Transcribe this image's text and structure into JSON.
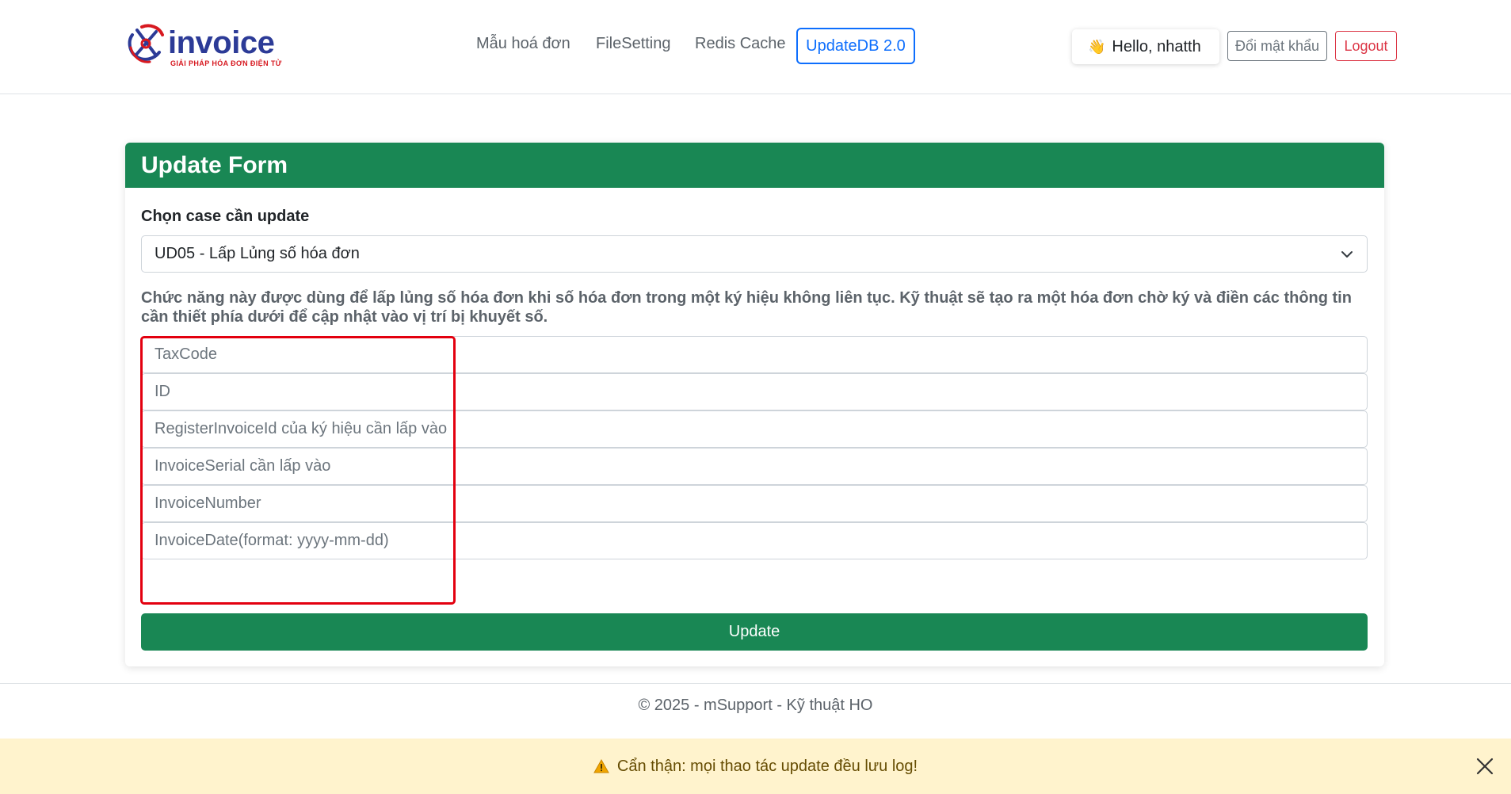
{
  "brand": {
    "logo_text": "invoice",
    "logo_tagline": "GIẢI PHÁP HÓA ĐƠN ĐIỆN TỬ"
  },
  "nav": {
    "items": [
      {
        "label": "Mẫu hoá đơn"
      },
      {
        "label": "FileSetting"
      },
      {
        "label": "Redis Cache"
      },
      {
        "label": "UpdateDB 2.0",
        "active": true
      }
    ]
  },
  "user": {
    "wave_icon": "waving-hand-icon",
    "greeting": "Hello, nhatth",
    "change_password_label": "Đổi mật khẩu",
    "logout_label": "Logout"
  },
  "card": {
    "title": "Update Form",
    "case_label": "Chọn case cần update",
    "case_selected": "UD05 - Lấp Lủng số hóa đơn",
    "description": "Chức năng này được dùng để lấp lủng số hóa đơn khi số hóa đơn trong một ký hiệu không liên tục. Kỹ thuật sẽ tạo ra một hóa đơn chờ ký và điền các thông tin cần thiết phía dưới để cập nhật vào vị trí bị khuyết số.",
    "fields": [
      {
        "placeholder": "TaxCode",
        "value": ""
      },
      {
        "placeholder": "ID",
        "value": ""
      },
      {
        "placeholder": "RegisterInvoiceId của ký hiệu cần lấp vào",
        "value": ""
      },
      {
        "placeholder": "InvoiceSerial cần lấp vào",
        "value": ""
      },
      {
        "placeholder": "InvoiceNumber",
        "value": ""
      },
      {
        "placeholder": "InvoiceDate(format: yyyy-mm-dd)",
        "value": ""
      }
    ],
    "submit_label": "Update"
  },
  "footer": {
    "text": "© 2025 - mSupport - Kỹ thuật HO"
  },
  "alert": {
    "icon": "warning-icon",
    "text": "Cẩn thận: mọi thao tác update đều lưu log!"
  },
  "colors": {
    "primary": "#0d6efd",
    "success": "#198754",
    "danger": "#dc3545",
    "highlight": "#e3000f",
    "alert_bg": "#fff3cd",
    "brand_blue": "#2c3b97",
    "brand_red": "#d71920"
  }
}
